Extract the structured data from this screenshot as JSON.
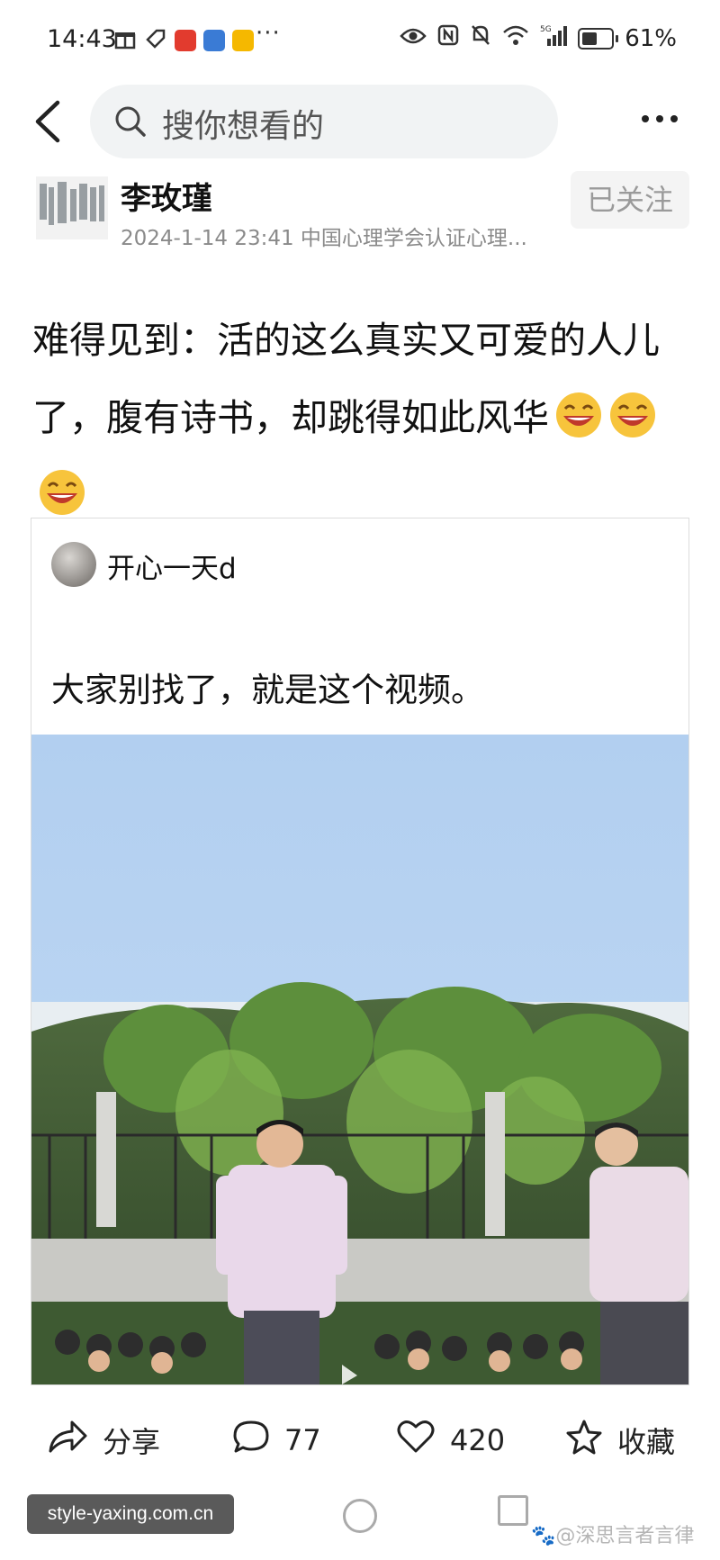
{
  "status_bar": {
    "time": "14:43",
    "more_notifications": "···",
    "battery_percent": "61%",
    "battery_level": 0.61,
    "network": "5G"
  },
  "top_bar": {
    "search_placeholder": "搜你想看的"
  },
  "author": {
    "name": "李玫瑾",
    "meta": "2024-1-14 23:41 中国心理学会认证心理...",
    "follow_label": "已关注"
  },
  "post": {
    "text": "难得见到：活的这么真实又可爱的人儿了，腹有诗书，却跳得如此风华",
    "emoji": "laughing-face-icon",
    "emoji_count": 3
  },
  "quoted": {
    "author": "开心一天d",
    "text": "大家别找了，就是这个视频。"
  },
  "actions": {
    "share_label": "分享",
    "comment_count": "77",
    "like_count": "420",
    "favorite_label": "收藏"
  },
  "footer": {
    "watermark": "style-yaxing.com.cn",
    "credit": "@深思言者言律"
  },
  "colors": {
    "sky": "#b8d3f0",
    "text": "#111111",
    "muted": "#8a8a8a"
  }
}
